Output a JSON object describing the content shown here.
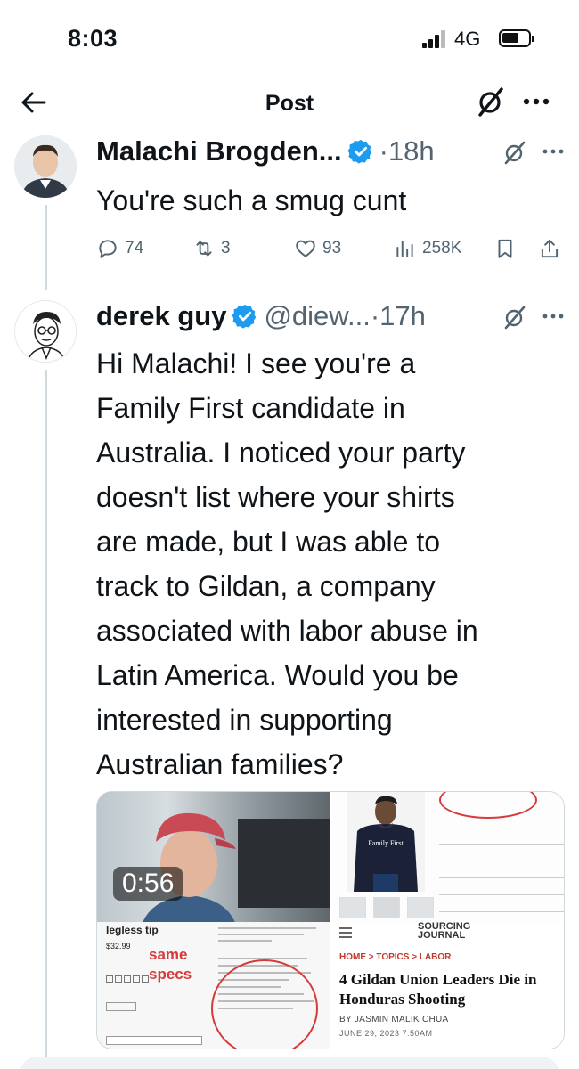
{
  "status_bar": {
    "time": "8:03",
    "network": "4G"
  },
  "nav": {
    "title": "Post",
    "icons": [
      "back-arrow-icon",
      "grok-icon",
      "more-icon"
    ]
  },
  "tweets": [
    {
      "author_name": "Malachi Brogden...",
      "verified": true,
      "handle": "",
      "separator": "·",
      "time": "18h",
      "text": "You're such a smug cunt",
      "actions": {
        "replies": "74",
        "reposts": "3",
        "likes": "93",
        "views": "258K"
      }
    },
    {
      "author_name": "derek guy",
      "verified": true,
      "handle": "@diew...",
      "separator": "·",
      "time": "17h",
      "text_lines": [
        "Hi Malachi! I see you're a",
        "Family First candidate in",
        "Australia. I noticed your party",
        "doesn't list where your shirts",
        "are made, but I was able to",
        "track to Gildan, a company",
        "associated with labor abuse in",
        "Latin America. Would you be",
        "interested in supporting",
        "Australian families?"
      ],
      "media": {
        "video_duration": "0:56",
        "annotation_line1": "same",
        "annotation_line2": "specs",
        "product_heading": "legless tip",
        "product_price": "$32.99",
        "article": {
          "logo_line1": "SOURCING",
          "logo_line2": "JOURNAL",
          "breadcrumb": "HOME > TOPICS > LABOR",
          "headline": "4 Gildan Union Leaders Die in Honduras Shooting",
          "byline": "BY JASMIN MALIK CHUA",
          "date": "JUNE 29, 2023 7:50AM"
        },
        "shirt_print": "Family First"
      }
    }
  ],
  "colors": {
    "verified_blue": "#1d9bf0",
    "muted_text": "#536471",
    "annotation_red": "#d63a3a"
  }
}
